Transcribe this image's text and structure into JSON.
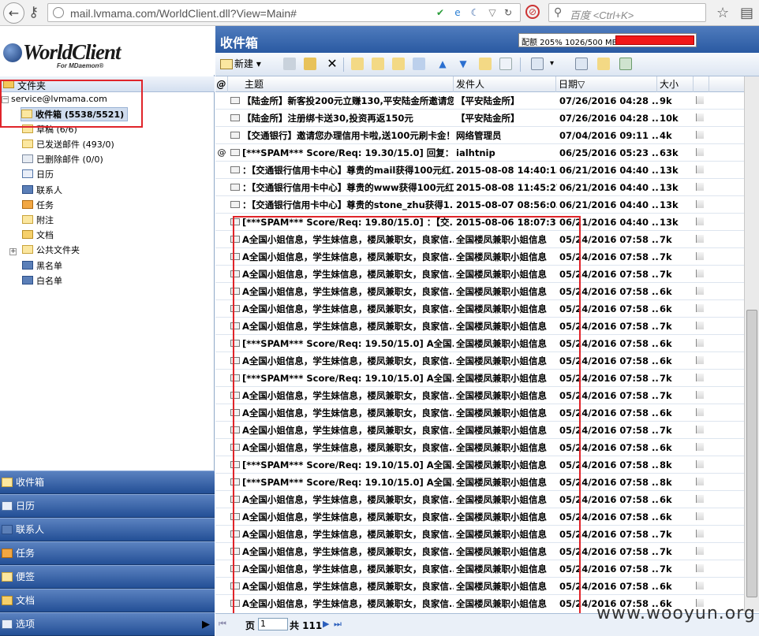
{
  "browser": {
    "url": "mail.lvmama.com/WorldClient.dll?View=Main#",
    "search_placeholder": "百度 <Ctrl+K>"
  },
  "app": {
    "brand": "WorldClient",
    "brand_sub": "For MDaemon®",
    "folders_header": "文件夹",
    "account": "service@lvmama.com"
  },
  "tree": [
    {
      "label": "收件箱 (5538/5521)",
      "icon": "inbox-icon",
      "selected": true
    },
    {
      "label": "草稿 (6/6)",
      "icon": "drafts-icon"
    },
    {
      "label": "已发送邮件 (493/0)",
      "icon": "sent-icon"
    },
    {
      "label": "已删除邮件 (0/0)",
      "icon": "deleted-icon"
    },
    {
      "label": "日历",
      "icon": "calendar-icon"
    },
    {
      "label": "联系人",
      "icon": "contacts-icon"
    },
    {
      "label": "任务",
      "icon": "tasks-icon"
    },
    {
      "label": "附注",
      "icon": "notes-icon"
    },
    {
      "label": "文档",
      "icon": "documents-icon"
    },
    {
      "label": "公共文件夹",
      "icon": "public-folder-icon"
    },
    {
      "label": "黑名单",
      "icon": "blacklist-icon"
    },
    {
      "label": "白名单",
      "icon": "whitelist-icon"
    }
  ],
  "nav": [
    {
      "label": "收件箱",
      "icon": "inbox-icon"
    },
    {
      "label": "日历",
      "icon": "calendar-icon"
    },
    {
      "label": "联系人",
      "icon": "contacts-icon"
    },
    {
      "label": "任务",
      "icon": "tasks-icon"
    },
    {
      "label": "便签",
      "icon": "notes-icon"
    },
    {
      "label": "文档",
      "icon": "documents-icon"
    },
    {
      "label": "选项",
      "icon": "options-icon"
    }
  ],
  "main": {
    "title": "收件箱",
    "quota_text": "配额 205% 1026/500 MB",
    "quota_fraction": 1.0,
    "quota_color": "#f01818",
    "new_label": "新建",
    "columns": {
      "attach": "@",
      "subject": "主题",
      "from": "发件人",
      "date": "日期▽",
      "size": "大小"
    }
  },
  "messages": [
    {
      "a": "",
      "s": "【陆金所】新客投200元立赚130,平安陆金所邀请您...",
      "f": "【平安陆金所】",
      "d": "07/26/2016 04:28 ...",
      "z": "9k"
    },
    {
      "a": "",
      "s": "【陆金所】注册绑卡送30,投资再返150元",
      "f": "【平安陆金所】",
      "d": "07/26/2016 04:28 ...",
      "z": "10k"
    },
    {
      "a": "",
      "s": "【交通银行】邀请您办理信用卡啦,送100元刷卡金！",
      "f": "网络管理员",
      "d": "07/04/2016 09:11 ...",
      "z": "4k"
    },
    {
      "a": "@",
      "s": "[***SPAM*** Score/Req: 19.30/15.0] 回复：",
      "f": "ialhtnip",
      "d": "06/25/2016 05:23 ...",
      "z": "63k"
    },
    {
      "a": "",
      "s": "：【交通银行信用卡中心】尊贵的mail获得100元红...",
      "f": "2015-08-08 14:40:15",
      "d": "06/21/2016 04:40 ...",
      "z": "13k"
    },
    {
      "a": "",
      "s": "：【交通银行信用卡中心】尊贵的www获得100元红...",
      "f": "2015-08-08 11:45:27",
      "d": "06/21/2016 04:40 ...",
      "z": "13k"
    },
    {
      "a": "",
      "s": "：【交通银行信用卡中心】尊贵的stone_zhu获得1...",
      "f": "2015-08-07 08:56:03",
      "d": "06/21/2016 04:40 ...",
      "z": "13k"
    },
    {
      "a": "",
      "s": "[***SPAM*** Score/Req: 19.80/15.0] ：【交...",
      "f": "2015-08-06 18:07:31",
      "d": "06/21/2016 04:40 ...",
      "z": "13k"
    },
    {
      "a": "",
      "s": "A全国小姐信息，学生妹信息，楼凤兼职女，良家信...",
      "f": "全国楼凤兼职小姐信息",
      "d": "05/24/2016 07:58 ...",
      "z": "7k"
    },
    {
      "a": "",
      "s": "A全国小姐信息，学生妹信息，楼凤兼职女，良家信...",
      "f": "全国楼凤兼职小姐信息",
      "d": "05/24/2016 07:58 ...",
      "z": "7k"
    },
    {
      "a": "",
      "s": "A全国小姐信息，学生妹信息，楼凤兼职女，良家信...",
      "f": "全国楼凤兼职小姐信息",
      "d": "05/24/2016 07:58 ...",
      "z": "7k"
    },
    {
      "a": "",
      "s": "A全国小姐信息，学生妹信息，楼凤兼职女，良家信...",
      "f": "全国楼凤兼职小姐信息",
      "d": "05/24/2016 07:58 ...",
      "z": "6k"
    },
    {
      "a": "",
      "s": "A全国小姐信息，学生妹信息，楼凤兼职女，良家信...",
      "f": "全国楼凤兼职小姐信息",
      "d": "05/24/2016 07:58 ...",
      "z": "6k"
    },
    {
      "a": "",
      "s": "A全国小姐信息，学生妹信息，楼凤兼职女，良家信...",
      "f": "全国楼凤兼职小姐信息",
      "d": "05/24/2016 07:58 ...",
      "z": "7k"
    },
    {
      "a": "",
      "s": "[***SPAM*** Score/Req: 19.50/15.0] A全国...",
      "f": "全国楼凤兼职小姐信息",
      "d": "05/24/2016 07:58 ...",
      "z": "6k"
    },
    {
      "a": "",
      "s": "A全国小姐信息，学生妹信息，楼凤兼职女，良家信...",
      "f": "全国楼凤兼职小姐信息",
      "d": "05/24/2016 07:58 ...",
      "z": "6k"
    },
    {
      "a": "",
      "s": "[***SPAM*** Score/Req: 19.10/15.0] A全国...",
      "f": "全国楼凤兼职小姐信息",
      "d": "05/24/2016 07:58 ...",
      "z": "7k"
    },
    {
      "a": "",
      "s": "A全国小姐信息，学生妹信息，楼凤兼职女，良家信...",
      "f": "全国楼凤兼职小姐信息",
      "d": "05/24/2016 07:58 ...",
      "z": "7k"
    },
    {
      "a": "",
      "s": "A全国小姐信息，学生妹信息，楼凤兼职女，良家信...",
      "f": "全国楼凤兼职小姐信息",
      "d": "05/24/2016 07:58 ...",
      "z": "6k"
    },
    {
      "a": "",
      "s": "A全国小姐信息，学生妹信息，楼凤兼职女，良家信...",
      "f": "全国楼凤兼职小姐信息",
      "d": "05/24/2016 07:58 ...",
      "z": "7k"
    },
    {
      "a": "",
      "s": "A全国小姐信息，学生妹信息，楼凤兼职女，良家信...",
      "f": "全国楼凤兼职小姐信息",
      "d": "05/24/2016 07:58 ...",
      "z": "6k"
    },
    {
      "a": "",
      "s": "[***SPAM*** Score/Req: 19.10/15.0] A全国...",
      "f": "全国楼凤兼职小姐信息",
      "d": "05/24/2016 07:58 ...",
      "z": "8k"
    },
    {
      "a": "",
      "s": "[***SPAM*** Score/Req: 19.10/15.0] A全国...",
      "f": "全国楼凤兼职小姐信息",
      "d": "05/24/2016 07:58 ...",
      "z": "8k"
    },
    {
      "a": "",
      "s": "A全国小姐信息，学生妹信息，楼凤兼职女，良家信...",
      "f": "全国楼凤兼职小姐信息",
      "d": "05/24/2016 07:58 ...",
      "z": "6k"
    },
    {
      "a": "",
      "s": "A全国小姐信息，学生妹信息，楼凤兼职女，良家信...",
      "f": "全国楼凤兼职小姐信息",
      "d": "05/24/2016 07:58 ...",
      "z": "6k"
    },
    {
      "a": "",
      "s": "A全国小姐信息，学生妹信息，楼凤兼职女，良家信...",
      "f": "全国楼凤兼职小姐信息",
      "d": "05/24/2016 07:58 ...",
      "z": "7k"
    },
    {
      "a": "",
      "s": "A全国小姐信息，学生妹信息，楼凤兼职女，良家信...",
      "f": "全国楼凤兼职小姐信息",
      "d": "05/24/2016 07:58 ...",
      "z": "7k"
    },
    {
      "a": "",
      "s": "A全国小姐信息，学生妹信息，楼凤兼职女，良家信...",
      "f": "全国楼凤兼职小姐信息",
      "d": "05/24/2016 07:58 ...",
      "z": "7k"
    },
    {
      "a": "",
      "s": "A全国小姐信息，学生妹信息，楼凤兼职女，良家信...",
      "f": "全国楼凤兼职小姐信息",
      "d": "05/24/2016 07:58 ...",
      "z": "6k"
    },
    {
      "a": "",
      "s": "A全国小姐信息，学生妹信息，楼凤兼职女，良家信...",
      "f": "全国楼凤兼职小姐信息",
      "d": "05/24/2016 07:58 ...",
      "z": "6k"
    }
  ],
  "pager": {
    "page_label": "页",
    "page_value": "1",
    "total_label": "共 111"
  },
  "watermark": "www.wooyun.org"
}
